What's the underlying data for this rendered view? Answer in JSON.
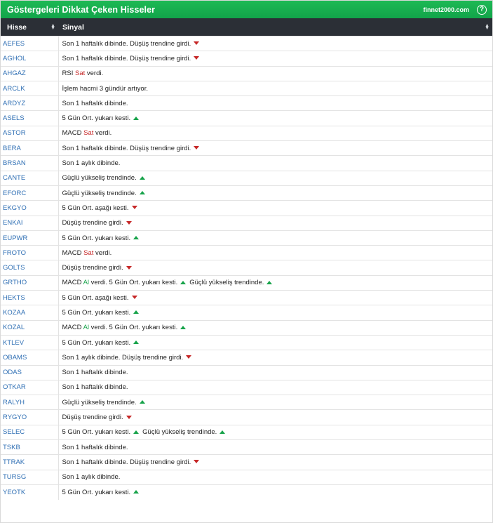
{
  "header": {
    "title": "Göstergeleri Dikkat Çeken Hisseler",
    "brand": "finnet2000.com",
    "help": "?"
  },
  "columns": {
    "symbol": "Hisse",
    "signal": "Sinyal"
  },
  "colors": {
    "header_bg": "#16a34a",
    "thead_bg": "#2b2f36",
    "up": "#17a34a",
    "down": "#c62828",
    "link": "#2f6fb4"
  },
  "rows": [
    {
      "symbol": "AEFES",
      "parts": [
        {
          "t": "Son 1 haftalık dibinde. Düşüş trendine girdi."
        },
        {
          "icon": "down"
        }
      ]
    },
    {
      "symbol": "AGHOL",
      "parts": [
        {
          "t": "Son 1 haftalık dibinde. Düşüş trendine girdi."
        },
        {
          "icon": "down"
        }
      ]
    },
    {
      "symbol": "AHGAZ",
      "parts": [
        {
          "t": "RSI "
        },
        {
          "t": "Sat",
          "c": "red"
        },
        {
          "t": " verdi."
        }
      ]
    },
    {
      "symbol": "ARCLK",
      "parts": [
        {
          "t": "İşlem hacmi 3 gündür artıyor."
        }
      ]
    },
    {
      "symbol": "ARDYZ",
      "parts": [
        {
          "t": "Son 1 haftalık dibinde."
        }
      ]
    },
    {
      "symbol": "ASELS",
      "parts": [
        {
          "t": "5 Gün Ort. yukarı kesti."
        },
        {
          "icon": "up"
        }
      ]
    },
    {
      "symbol": "ASTOR",
      "parts": [
        {
          "t": "MACD "
        },
        {
          "t": "Sat",
          "c": "red"
        },
        {
          "t": " verdi."
        }
      ]
    },
    {
      "symbol": "BERA",
      "parts": [
        {
          "t": "Son 1 haftalık dibinde. Düşüş trendine girdi."
        },
        {
          "icon": "down"
        }
      ]
    },
    {
      "symbol": "BRSAN",
      "parts": [
        {
          "t": "Son 1 aylık dibinde."
        }
      ]
    },
    {
      "symbol": "CANTE",
      "parts": [
        {
          "t": "Güçlü yükseliş trendinde."
        },
        {
          "icon": "up"
        }
      ]
    },
    {
      "symbol": "EFORC",
      "parts": [
        {
          "t": "Güçlü yükseliş trendinde."
        },
        {
          "icon": "up"
        }
      ]
    },
    {
      "symbol": "EKGYO",
      "parts": [
        {
          "t": "5 Gün Ort. aşağı kesti."
        },
        {
          "icon": "down"
        }
      ]
    },
    {
      "symbol": "ENKAI",
      "parts": [
        {
          "t": "Düşüş trendine girdi."
        },
        {
          "icon": "down"
        }
      ]
    },
    {
      "symbol": "EUPWR",
      "parts": [
        {
          "t": "5 Gün Ort. yukarı kesti."
        },
        {
          "icon": "up"
        }
      ]
    },
    {
      "symbol": "FROTO",
      "parts": [
        {
          "t": "MACD "
        },
        {
          "t": "Sat",
          "c": "red"
        },
        {
          "t": " verdi."
        }
      ]
    },
    {
      "symbol": "GOLTS",
      "parts": [
        {
          "t": "Düşüş trendine girdi."
        },
        {
          "icon": "down"
        }
      ]
    },
    {
      "symbol": "GRTHO",
      "parts": [
        {
          "t": "MACD "
        },
        {
          "t": "Al",
          "c": "green"
        },
        {
          "t": " verdi. 5 Gün Ort. yukarı kesti."
        },
        {
          "icon": "up"
        },
        {
          "t": "Güçlü yükseliş trendinde."
        },
        {
          "icon": "up"
        }
      ]
    },
    {
      "symbol": "HEKTS",
      "parts": [
        {
          "t": "5 Gün Ort. aşağı kesti."
        },
        {
          "icon": "down"
        }
      ]
    },
    {
      "symbol": "KOZAA",
      "parts": [
        {
          "t": "5 Gün Ort. yukarı kesti."
        },
        {
          "icon": "up"
        }
      ]
    },
    {
      "symbol": "KOZAL",
      "parts": [
        {
          "t": "MACD "
        },
        {
          "t": "Al",
          "c": "green"
        },
        {
          "t": " verdi. 5 Gün Ort. yukarı kesti."
        },
        {
          "icon": "up"
        }
      ]
    },
    {
      "symbol": "KTLEV",
      "parts": [
        {
          "t": "5 Gün Ort. yukarı kesti."
        },
        {
          "icon": "up"
        }
      ]
    },
    {
      "symbol": "OBAMS",
      "parts": [
        {
          "t": "Son 1 aylık dibinde. Düşüş trendine girdi."
        },
        {
          "icon": "down"
        }
      ]
    },
    {
      "symbol": "ODAS",
      "parts": [
        {
          "t": "Son 1 haftalık dibinde."
        }
      ]
    },
    {
      "symbol": "OTKAR",
      "parts": [
        {
          "t": "Son 1 haftalık dibinde."
        }
      ]
    },
    {
      "symbol": "RALYH",
      "parts": [
        {
          "t": "Güçlü yükseliş trendinde."
        },
        {
          "icon": "up"
        }
      ]
    },
    {
      "symbol": "RYGYO",
      "parts": [
        {
          "t": "Düşüş trendine girdi."
        },
        {
          "icon": "down"
        }
      ]
    },
    {
      "symbol": "SELEC",
      "parts": [
        {
          "t": "5 Gün Ort. yukarı kesti."
        },
        {
          "icon": "up"
        },
        {
          "t": "Güçlü yükseliş trendinde."
        },
        {
          "icon": "up"
        }
      ]
    },
    {
      "symbol": "TSKB",
      "parts": [
        {
          "t": "Son 1 haftalık dibinde."
        }
      ]
    },
    {
      "symbol": "TTRAK",
      "parts": [
        {
          "t": "Son 1 haftalık dibinde. Düşüş trendine girdi."
        },
        {
          "icon": "down"
        }
      ]
    },
    {
      "symbol": "TURSG",
      "parts": [
        {
          "t": "Son 1 aylık dibinde."
        }
      ]
    },
    {
      "symbol": "YEOTK",
      "parts": [
        {
          "t": "5 Gün Ort. yukarı kesti."
        },
        {
          "icon": "up"
        }
      ]
    }
  ]
}
